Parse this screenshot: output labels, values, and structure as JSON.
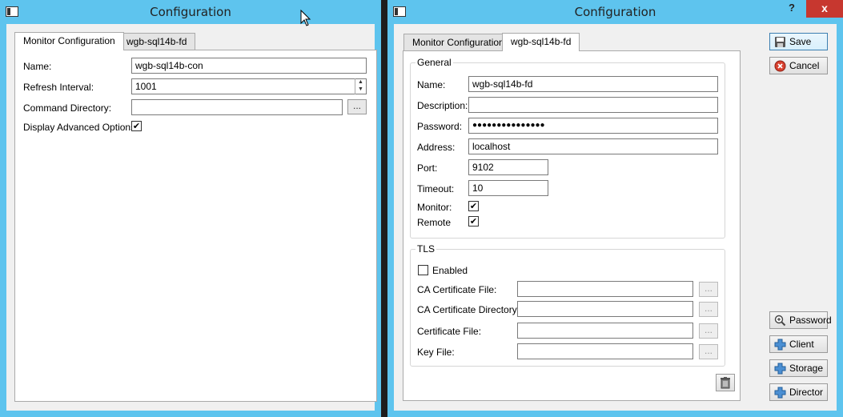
{
  "left_window": {
    "title": "Configuration",
    "tabs": [
      {
        "label": "Monitor Configuration",
        "active": true
      },
      {
        "label": "wgb-sql14b-fd",
        "active": false
      }
    ],
    "fields": {
      "name_label": "Name:",
      "name_value": "wgb-sql14b-con",
      "refresh_label": "Refresh Interval:",
      "refresh_value": "1001",
      "cmddir_label": "Command Directory:",
      "cmddir_value": "",
      "browse_label": "...",
      "advanced_label": "Display Advanced Options:",
      "advanced_checked": true
    }
  },
  "right_window": {
    "title": "Configuration",
    "title_controls": {
      "help": "?",
      "close": "x"
    },
    "tabs": [
      {
        "label": "Monitor Configuration",
        "active": false
      },
      {
        "label": "wgb-sql14b-fd",
        "active": true
      }
    ],
    "general": {
      "title": "General",
      "name_label": "Name:",
      "name_value": "wgb-sql14b-fd",
      "description_label": "Description:",
      "description_value": "",
      "password_label": "Password:",
      "password_value": "●●●●●●●●●●●●●●●",
      "address_label": "Address:",
      "address_value": "localhost",
      "port_label": "Port:",
      "port_value": "9102",
      "timeout_label": "Timeout:",
      "timeout_value": "10",
      "monitor_label": "Monitor:",
      "monitor_checked": true,
      "remote_label": "Remote",
      "remote_checked": true
    },
    "tls": {
      "title": "TLS",
      "enabled_label": "Enabled",
      "enabled_checked": false,
      "ca_file_label": "CA Certificate File:",
      "ca_dir_label": "CA Certificate Directory:",
      "cert_file_label": "Certificate File:",
      "key_file_label": "Key File:",
      "browse_label": "..."
    },
    "buttons": {
      "save": "Save",
      "cancel": "Cancel",
      "password": "Password",
      "client": "Client",
      "storage": "Storage",
      "director": "Director"
    },
    "colors": {
      "titlebar": "#5ec4ee",
      "close": "#c7372f"
    }
  }
}
